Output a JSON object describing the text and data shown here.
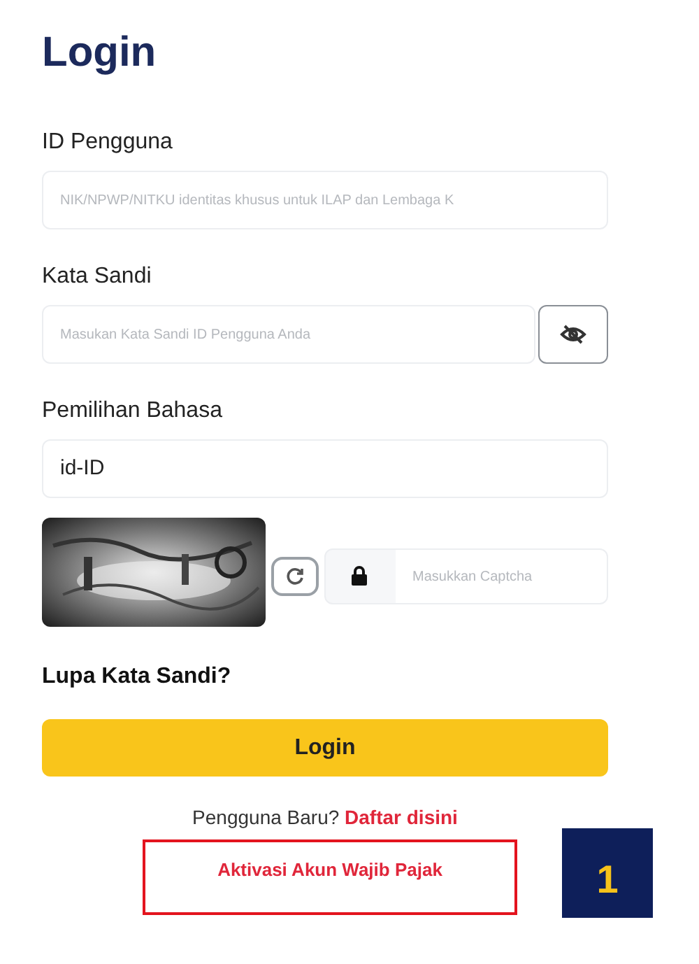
{
  "title": "Login",
  "fields": [
    {
      "kind": "text",
      "label": "ID Pengguna",
      "placeholder": "NIK/NPWP/NITKU identitas khusus untuk ILAP dan Lembaga K"
    },
    {
      "kind": "password",
      "label": "Kata Sandi",
      "placeholder": "Masukan Kata Sandi ID Pengguna Anda"
    },
    {
      "kind": "select",
      "label": "Pemilihan Bahasa",
      "value": "id-ID"
    }
  ],
  "captcha": {
    "placeholder": "Masukkan Captcha"
  },
  "forgot_link": "Lupa Kata Sandi?",
  "login_button": "Login",
  "register": {
    "prompt": "Pengguna Baru?",
    "link": "Daftar disini"
  },
  "activation_link": "Aktivasi Akun Wajib Pajak",
  "step_badge": "1"
}
